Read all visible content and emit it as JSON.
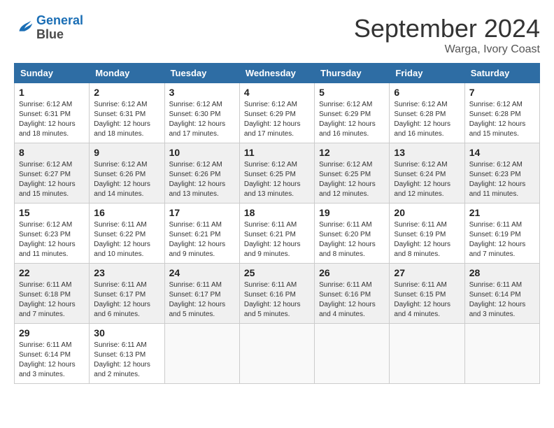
{
  "header": {
    "logo_line1": "General",
    "logo_line2": "Blue",
    "month_title": "September 2024",
    "location": "Warga, Ivory Coast"
  },
  "columns": [
    "Sunday",
    "Monday",
    "Tuesday",
    "Wednesday",
    "Thursday",
    "Friday",
    "Saturday"
  ],
  "weeks": [
    [
      {
        "day": "1",
        "sunrise": "Sunrise: 6:12 AM",
        "sunset": "Sunset: 6:31 PM",
        "daylight": "Daylight: 12 hours and 18 minutes."
      },
      {
        "day": "2",
        "sunrise": "Sunrise: 6:12 AM",
        "sunset": "Sunset: 6:31 PM",
        "daylight": "Daylight: 12 hours and 18 minutes."
      },
      {
        "day": "3",
        "sunrise": "Sunrise: 6:12 AM",
        "sunset": "Sunset: 6:30 PM",
        "daylight": "Daylight: 12 hours and 17 minutes."
      },
      {
        "day": "4",
        "sunrise": "Sunrise: 6:12 AM",
        "sunset": "Sunset: 6:29 PM",
        "daylight": "Daylight: 12 hours and 17 minutes."
      },
      {
        "day": "5",
        "sunrise": "Sunrise: 6:12 AM",
        "sunset": "Sunset: 6:29 PM",
        "daylight": "Daylight: 12 hours and 16 minutes."
      },
      {
        "day": "6",
        "sunrise": "Sunrise: 6:12 AM",
        "sunset": "Sunset: 6:28 PM",
        "daylight": "Daylight: 12 hours and 16 minutes."
      },
      {
        "day": "7",
        "sunrise": "Sunrise: 6:12 AM",
        "sunset": "Sunset: 6:28 PM",
        "daylight": "Daylight: 12 hours and 15 minutes."
      }
    ],
    [
      {
        "day": "8",
        "sunrise": "Sunrise: 6:12 AM",
        "sunset": "Sunset: 6:27 PM",
        "daylight": "Daylight: 12 hours and 15 minutes."
      },
      {
        "day": "9",
        "sunrise": "Sunrise: 6:12 AM",
        "sunset": "Sunset: 6:26 PM",
        "daylight": "Daylight: 12 hours and 14 minutes."
      },
      {
        "day": "10",
        "sunrise": "Sunrise: 6:12 AM",
        "sunset": "Sunset: 6:26 PM",
        "daylight": "Daylight: 12 hours and 13 minutes."
      },
      {
        "day": "11",
        "sunrise": "Sunrise: 6:12 AM",
        "sunset": "Sunset: 6:25 PM",
        "daylight": "Daylight: 12 hours and 13 minutes."
      },
      {
        "day": "12",
        "sunrise": "Sunrise: 6:12 AM",
        "sunset": "Sunset: 6:25 PM",
        "daylight": "Daylight: 12 hours and 12 minutes."
      },
      {
        "day": "13",
        "sunrise": "Sunrise: 6:12 AM",
        "sunset": "Sunset: 6:24 PM",
        "daylight": "Daylight: 12 hours and 12 minutes."
      },
      {
        "day": "14",
        "sunrise": "Sunrise: 6:12 AM",
        "sunset": "Sunset: 6:23 PM",
        "daylight": "Daylight: 12 hours and 11 minutes."
      }
    ],
    [
      {
        "day": "15",
        "sunrise": "Sunrise: 6:12 AM",
        "sunset": "Sunset: 6:23 PM",
        "daylight": "Daylight: 12 hours and 11 minutes."
      },
      {
        "day": "16",
        "sunrise": "Sunrise: 6:11 AM",
        "sunset": "Sunset: 6:22 PM",
        "daylight": "Daylight: 12 hours and 10 minutes."
      },
      {
        "day": "17",
        "sunrise": "Sunrise: 6:11 AM",
        "sunset": "Sunset: 6:21 PM",
        "daylight": "Daylight: 12 hours and 9 minutes."
      },
      {
        "day": "18",
        "sunrise": "Sunrise: 6:11 AM",
        "sunset": "Sunset: 6:21 PM",
        "daylight": "Daylight: 12 hours and 9 minutes."
      },
      {
        "day": "19",
        "sunrise": "Sunrise: 6:11 AM",
        "sunset": "Sunset: 6:20 PM",
        "daylight": "Daylight: 12 hours and 8 minutes."
      },
      {
        "day": "20",
        "sunrise": "Sunrise: 6:11 AM",
        "sunset": "Sunset: 6:19 PM",
        "daylight": "Daylight: 12 hours and 8 minutes."
      },
      {
        "day": "21",
        "sunrise": "Sunrise: 6:11 AM",
        "sunset": "Sunset: 6:19 PM",
        "daylight": "Daylight: 12 hours and 7 minutes."
      }
    ],
    [
      {
        "day": "22",
        "sunrise": "Sunrise: 6:11 AM",
        "sunset": "Sunset: 6:18 PM",
        "daylight": "Daylight: 12 hours and 7 minutes."
      },
      {
        "day": "23",
        "sunrise": "Sunrise: 6:11 AM",
        "sunset": "Sunset: 6:17 PM",
        "daylight": "Daylight: 12 hours and 6 minutes."
      },
      {
        "day": "24",
        "sunrise": "Sunrise: 6:11 AM",
        "sunset": "Sunset: 6:17 PM",
        "daylight": "Daylight: 12 hours and 5 minutes."
      },
      {
        "day": "25",
        "sunrise": "Sunrise: 6:11 AM",
        "sunset": "Sunset: 6:16 PM",
        "daylight": "Daylight: 12 hours and 5 minutes."
      },
      {
        "day": "26",
        "sunrise": "Sunrise: 6:11 AM",
        "sunset": "Sunset: 6:16 PM",
        "daylight": "Daylight: 12 hours and 4 minutes."
      },
      {
        "day": "27",
        "sunrise": "Sunrise: 6:11 AM",
        "sunset": "Sunset: 6:15 PM",
        "daylight": "Daylight: 12 hours and 4 minutes."
      },
      {
        "day": "28",
        "sunrise": "Sunrise: 6:11 AM",
        "sunset": "Sunset: 6:14 PM",
        "daylight": "Daylight: 12 hours and 3 minutes."
      }
    ],
    [
      {
        "day": "29",
        "sunrise": "Sunrise: 6:11 AM",
        "sunset": "Sunset: 6:14 PM",
        "daylight": "Daylight: 12 hours and 3 minutes."
      },
      {
        "day": "30",
        "sunrise": "Sunrise: 6:11 AM",
        "sunset": "Sunset: 6:13 PM",
        "daylight": "Daylight: 12 hours and 2 minutes."
      },
      null,
      null,
      null,
      null,
      null
    ]
  ]
}
